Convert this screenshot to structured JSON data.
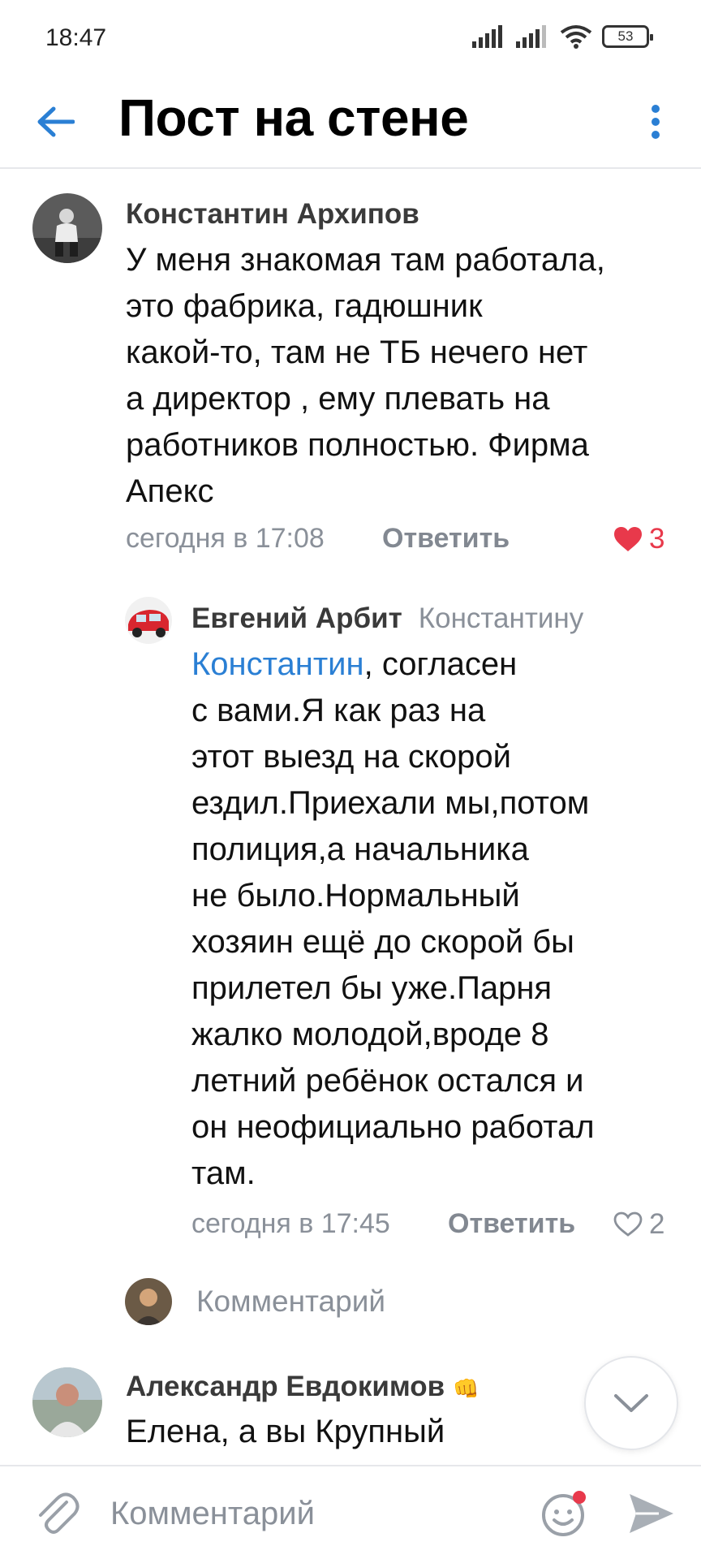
{
  "status": {
    "time": "18:47",
    "battery": "53"
  },
  "header": {
    "title": "Пост на стене"
  },
  "comments": [
    {
      "author": "Константин Архипов",
      "text_lines": [
        "У меня знакомая там работала,",
        "это фабрика,  гадюшник",
        "какой-то,  там не ТБ нечего нет",
        "а директор , ему плевать на",
        "работников полностью. Фирма",
        "Апекс"
      ],
      "time": "сегодня в 17:08",
      "reply_label": "Ответить",
      "likes": "3",
      "liked": true
    },
    {
      "author": "Евгений Арбит",
      "reply_to": "Константину",
      "mention": "Константин",
      "first_line_rest": ", согласен",
      "text_lines": [
        "с вами.Я как раз на",
        "этот выезд на скорой",
        "ездил.Приехали мы,потом",
        "полиция,а начальника",
        "не было.Нормальный",
        "хозяин ещё до скорой бы",
        "прилетел бы уже.Парня",
        "жалко молодой,вроде 8",
        "летний ребёнок остался и",
        "он неофициально работал",
        "там."
      ],
      "time": "сегодня в 17:45",
      "reply_label": "Ответить",
      "likes": "2",
      "liked": false
    },
    {
      "author": "Александр Евдокимов",
      "author_emoji": "👊",
      "text_lines": [
        "Елена, а вы Крупный"
      ]
    }
  ],
  "inline_comment": {
    "placeholder": "Комментарий"
  },
  "bottom_bar": {
    "placeholder": "Комментарий"
  },
  "colors": {
    "accent": "#2a7fd4",
    "like_red": "#e8394b",
    "secondary_text": "#8a9099",
    "divider": "#e6e7eb"
  },
  "icons": {
    "back": "arrow-left-icon",
    "menu": "more-vertical-icon",
    "like": "heart-icon",
    "scroll_down": "chevron-down-icon",
    "attach": "paperclip-icon",
    "emoji": "smile-icon",
    "send": "send-icon"
  }
}
